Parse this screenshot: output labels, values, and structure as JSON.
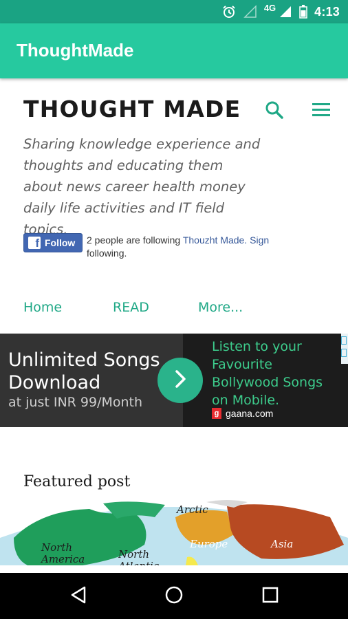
{
  "status_bar": {
    "network": "4G",
    "time": "4:13"
  },
  "app_bar": {
    "title": "ThoughtMade",
    "color": "#26c99f"
  },
  "blog": {
    "title": "THOUGHT MADE",
    "tagline": "Sharing knowledge experience and thoughts and educating them about news career health money daily life activities and IT field topics."
  },
  "follow": {
    "button_label": "Follow",
    "text_prefix": "2 people are following ",
    "link_text": "Thouzht Made.",
    "sign_text": "Sign",
    "text_suffix": "following."
  },
  "nav": {
    "home": "Home",
    "read": "READ",
    "more": "More..."
  },
  "ad": {
    "headline": "Unlimited Songs Download",
    "price": "at just INR 99/Month",
    "copy": "Listen to your Favourite Bollywood Songs on Mobile.",
    "source": "gaana.com"
  },
  "featured": {
    "heading": "Featured post",
    "map_labels": {
      "arctic": "Arctic",
      "europe": "Europe",
      "asia": "Asia",
      "north_america": "North America",
      "north_atlantic": "North Atlantic"
    }
  },
  "system_nav": {
    "back": "back-icon",
    "home": "home-icon",
    "recents": "recents-icon"
  },
  "colors": {
    "status_bar": "#1aa383",
    "accent": "#1fa886",
    "facebook": "#4267b2",
    "ad_green": "#3dcc8c"
  }
}
